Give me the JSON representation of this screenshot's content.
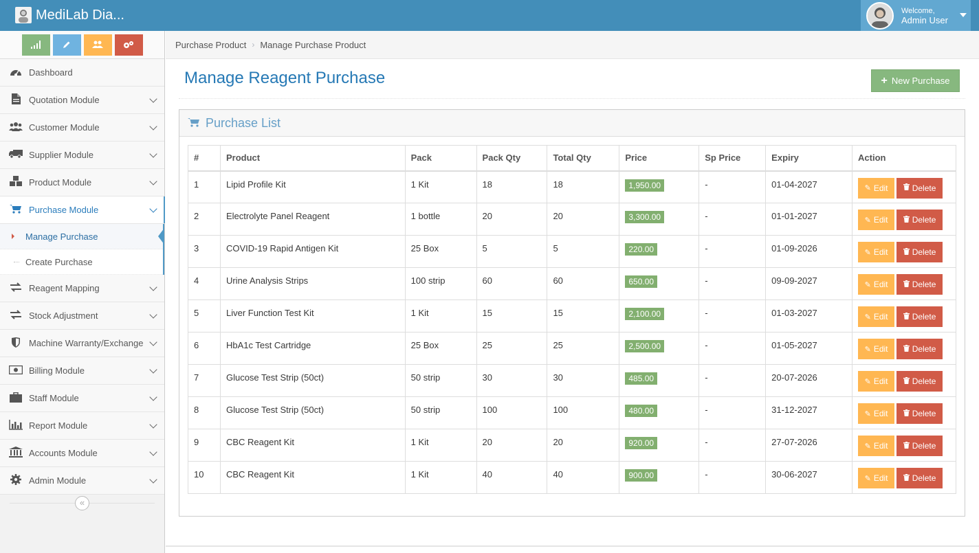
{
  "app": {
    "title": "MediLab Dia..."
  },
  "user": {
    "welcome": "Welcome,",
    "name": "Admin User"
  },
  "shortcuts": [
    {
      "icon": "signal-icon",
      "color": "#87b87f"
    },
    {
      "icon": "pencil-icon",
      "color": "#6fb3e0"
    },
    {
      "icon": "users-icon",
      "color": "#ffb752"
    },
    {
      "icon": "cogs-icon",
      "color": "#d15b47"
    }
  ],
  "sidebar": {
    "items": [
      {
        "label": "Dashboard",
        "icon": "dashboard-icon"
      },
      {
        "label": "Quotation Module",
        "icon": "document-icon"
      },
      {
        "label": "Customer Module",
        "icon": "users-icon"
      },
      {
        "label": "Supplier Module",
        "icon": "truck-icon"
      },
      {
        "label": "Product Module",
        "icon": "cubes-icon"
      },
      {
        "label": "Purchase Module",
        "icon": "cart-icon"
      },
      {
        "label": "Reagent Mapping",
        "icon": "exchange-icon"
      },
      {
        "label": "Stock Adjustment",
        "icon": "exchange-icon"
      },
      {
        "label": "Machine Warranty/Exchange",
        "icon": "shield-icon"
      },
      {
        "label": "Billing Module",
        "icon": "money-icon"
      },
      {
        "label": "Staff Module",
        "icon": "briefcase-icon"
      },
      {
        "label": "Report Module",
        "icon": "bar-chart-icon"
      },
      {
        "label": "Accounts Module",
        "icon": "bank-icon"
      },
      {
        "label": "Admin Module",
        "icon": "gear-icon"
      }
    ],
    "submenu": [
      {
        "label": "Manage Purchase"
      },
      {
        "label": "Create Purchase"
      }
    ]
  },
  "breadcrumb": {
    "parent": "Purchase Product",
    "current": "Manage Purchase Product"
  },
  "page": {
    "title": "Manage Reagent Purchase",
    "new_button": "New Purchase"
  },
  "widget": {
    "title": "Purchase List"
  },
  "table": {
    "headers": [
      "#",
      "Product",
      "Pack",
      "Pack Qty",
      "Total Qty",
      "Price",
      "Sp Price",
      "Expiry",
      "Action"
    ],
    "edit_label": "Edit",
    "delete_label": "Delete",
    "rows": [
      {
        "no": "1",
        "product": "Lipid Profile Kit",
        "pack": "1 Kit",
        "pack_qty": "18",
        "total_qty": "18",
        "price": "1,950.00",
        "sp_price": "-",
        "expiry": "01-04-2027"
      },
      {
        "no": "2",
        "product": "Electrolyte Panel Reagent",
        "pack": "1 bottle",
        "pack_qty": "20",
        "total_qty": "20",
        "price": "3,300.00",
        "sp_price": "-",
        "expiry": "01-01-2027"
      },
      {
        "no": "3",
        "product": "COVID-19 Rapid Antigen Kit",
        "pack": "25 Box",
        "pack_qty": "5",
        "total_qty": "5",
        "price": "220.00",
        "sp_price": "-",
        "expiry": "01-09-2026"
      },
      {
        "no": "4",
        "product": "Urine Analysis Strips",
        "pack": "100 strip",
        "pack_qty": "60",
        "total_qty": "60",
        "price": "650.00",
        "sp_price": "-",
        "expiry": "09-09-2027"
      },
      {
        "no": "5",
        "product": "Liver Function Test Kit",
        "pack": "1 Kit",
        "pack_qty": "15",
        "total_qty": "15",
        "price": "2,100.00",
        "sp_price": "-",
        "expiry": "01-03-2027"
      },
      {
        "no": "6",
        "product": "HbA1c Test Cartridge",
        "pack": "25 Box",
        "pack_qty": "25",
        "total_qty": "25",
        "price": "2,500.00",
        "sp_price": "-",
        "expiry": "01-05-2027"
      },
      {
        "no": "7",
        "product": "Glucose Test Strip (50ct)",
        "pack": "50 strip",
        "pack_qty": "30",
        "total_qty": "30",
        "price": "485.00",
        "sp_price": "-",
        "expiry": "20-07-2026"
      },
      {
        "no": "8",
        "product": "Glucose Test Strip (50ct)",
        "pack": "50 strip",
        "pack_qty": "100",
        "total_qty": "100",
        "price": "480.00",
        "sp_price": "-",
        "expiry": "31-12-2027"
      },
      {
        "no": "9",
        "product": "CBC Reagent Kit",
        "pack": "1 Kit",
        "pack_qty": "20",
        "total_qty": "20",
        "price": "920.00",
        "sp_price": "-",
        "expiry": "27-07-2026"
      },
      {
        "no": "10",
        "product": "CBC Reagent Kit",
        "pack": "1 Kit",
        "pack_qty": "40",
        "total_qty": "40",
        "price": "900.00",
        "sp_price": "-",
        "expiry": "30-06-2027"
      }
    ]
  },
  "colors": {
    "navbar": "#438eb9",
    "accent": "#2679b5",
    "success": "#87b87f",
    "warning": "#ffb752",
    "danger": "#d15b47"
  }
}
